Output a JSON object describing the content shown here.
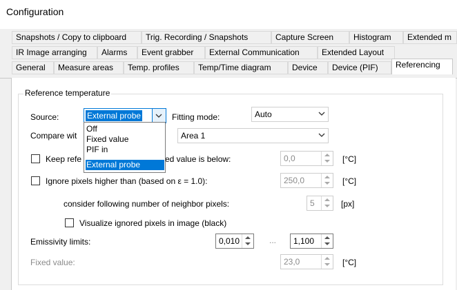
{
  "window": {
    "title": "Configuration"
  },
  "tabs": {
    "row1": [
      "Snapshots / Copy to clipboard",
      "Trig. Recording / Snapshots",
      "Capture Screen",
      "Histogram",
      "Extended m"
    ],
    "row2": [
      "IR Image arranging",
      "Alarms",
      "Event grabber",
      "External Communication",
      "Extended Layout"
    ],
    "row3": [
      "General",
      "Measure areas",
      "Temp. profiles",
      "Temp/Time diagram",
      "Device",
      "Device (PIF)",
      "Referencing"
    ]
  },
  "group": {
    "title": "Reference temperature"
  },
  "source": {
    "label": "Source:",
    "value": "External probe",
    "options": [
      "Off",
      "Fixed value",
      "PIF in",
      "External probe"
    ]
  },
  "fitting": {
    "label": "Fitting mode:",
    "value": "Auto"
  },
  "compare": {
    "label": "Compare wit",
    "value": "Area 1"
  },
  "keep": {
    "label_a": "Keep refe",
    "label_b": "ed value is below:",
    "value": "0,0",
    "unit": "[°C]"
  },
  "ignore": {
    "label": "Ignore pixels higher than (based on ε = 1.0):",
    "value": "250,0",
    "unit": "[°C]"
  },
  "neighbor": {
    "label": "consider following number of neighbor pixels:",
    "value": "5",
    "unit": "[px]"
  },
  "visualize": {
    "label": "Visualize ignored pixels in image (black)"
  },
  "emissivity": {
    "label": "Emissivity limits:",
    "min": "0,010",
    "sep": "...",
    "max": "1,100"
  },
  "fixed": {
    "label": "Fixed value:",
    "value": "23,0",
    "unit": "[°C]"
  }
}
